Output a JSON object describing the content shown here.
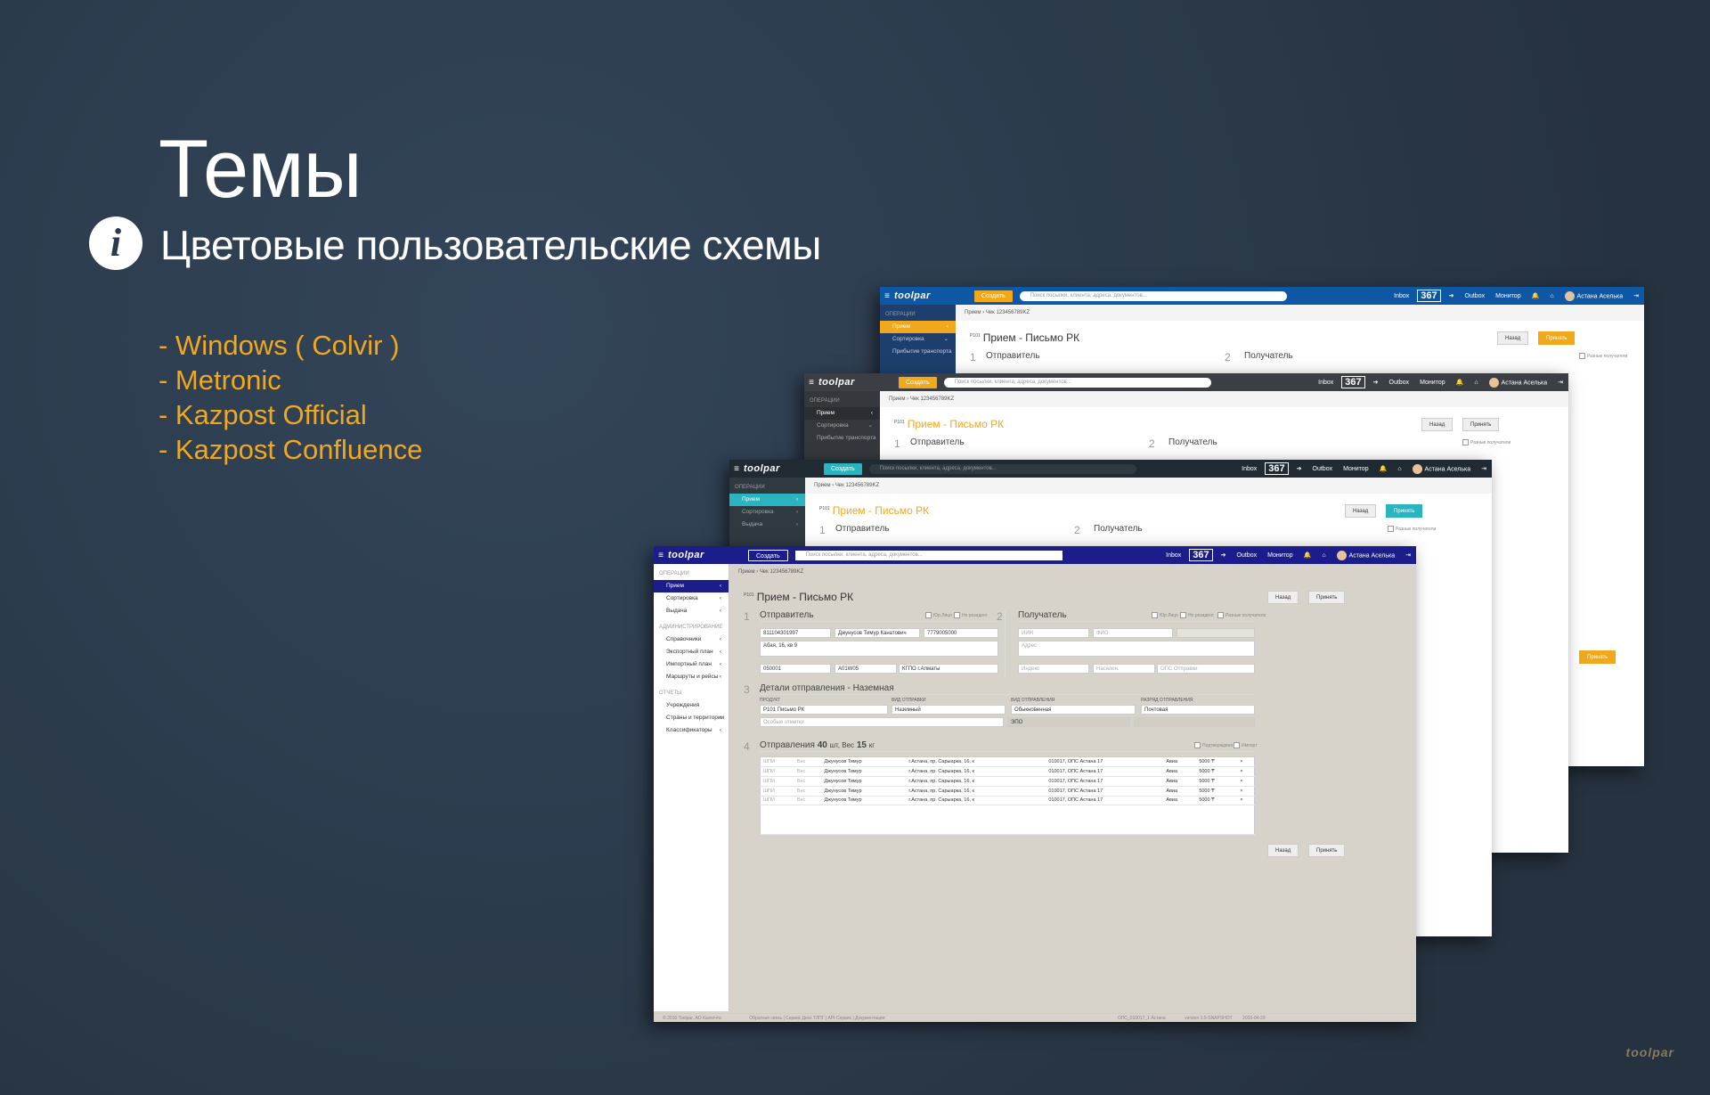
{
  "slide": {
    "title": "Темы",
    "subtitle": "Цветовые пользовательские схемы",
    "info_icon": "i",
    "themes": [
      "- Windows ( Colvir )",
      "- Metronic",
      "- Kazpost Official",
      "- Kazpost Confluence"
    ],
    "corner_logo": "toolpar",
    "accent_color": "#f2a81d",
    "background_color": "#2b3a4b"
  },
  "app": {
    "logo": "toolpar",
    "create_label": "Создать",
    "search_placeholder": "Поиск посылки, клиента, адреса, документов...",
    "inbox_label": "Inbox",
    "counter": "367",
    "outbox_label": "Outbox",
    "monitor_label": "Монитор",
    "user_name": "Астана Аселька",
    "breadcrumb_root": "Прием",
    "breadcrumb_item": "Чек 123456789KZ",
    "page_prefix": "P101",
    "page_title": "Прием - Письмо РК",
    "back_label": "Назад",
    "accept_label": "Принять",
    "sidebar": {
      "operations_head": "ОПЕРАЦИИ",
      "admin_head": "АДМИНИСТРИРОВАНИЕ",
      "reports_head": "ОТЧЕТЫ",
      "ops_items": [
        "Прием",
        "Сортировка",
        "Выдача"
      ],
      "admin_items": [
        "Справочники",
        "Экспортный план",
        "Импортный план",
        "Маршруты и рейсы"
      ],
      "report_items": [
        "Учреждения",
        "Страны и территории",
        "Классификаторы"
      ],
      "transport_item": "Прибытие транспорта"
    },
    "sender": {
      "num": "1",
      "title": "Отправитель",
      "iin": "811104301997",
      "name": "Джунусов Тимур Канатович",
      "phone": "7779005000",
      "address": "Абая, 16, кв 9",
      "index": "050001",
      "code": "A01W05",
      "ops": "КГПО г.Алматы",
      "chk_legal": "Юр.Лицо",
      "chk_resident": "Не резидент"
    },
    "receiver": {
      "num": "2",
      "title": "Получатель",
      "ph_iin": "ИИН",
      "ph_fio": "ФИО",
      "ph_address": "Адрес",
      "ph_index": "Индекс",
      "ph_city": "Населен.",
      "ph_ops": "ОПС Отправки",
      "chk_legal": "Юр.Лицо",
      "chk_resident": "Не резидент",
      "chk_diff": "Разные получатели"
    },
    "details": {
      "num": "3",
      "title": "Детали отправления - Наземная",
      "product_label": "ПРОДУКТ",
      "product_value": "P101 Письмо РК",
      "kind_label": "ВИД ОТПРАВКИ",
      "kind_value": "Наземный",
      "type_label": "ВИД ОТПРАВЛЕНИЯ",
      "type_value": "Обыкновенная",
      "rank_label": "РАЗРЯД ОТПРАВЛЕНИЯ",
      "rank_value": "Почтовая",
      "ph_notes": "Особые отметки",
      "epo_value": "ЭПО"
    },
    "shipments": {
      "num": "4",
      "title_prefix": "Отправления",
      "count": "40",
      "count_unit": "шт, Вес",
      "weight": "15",
      "weight_unit": "кг",
      "chk_confirm": "Подтверждено",
      "chk_import": "Импорт",
      "rows": [
        [
          "ШПИ",
          "Вес",
          "Джунусов Тимур",
          "г.Астана, пр. Сарыарка, 16, к",
          "010017, ОПС Астана 17",
          "Авиа",
          "5000 ₸",
          "×"
        ],
        [
          "ШПИ",
          "Вес",
          "Джунусов Тимур",
          "г.Астана, пр. Сарыарка, 16, к",
          "010017, ОПС Астана 17",
          "Авиа",
          "5000 ₸",
          "×"
        ],
        [
          "ШПИ",
          "Вес",
          "Джунусов Тимур",
          "г.Астана, пр. Сарыарка, 16, к",
          "010017, ОПС Астана 17",
          "Авиа",
          "5000 ₸",
          "×"
        ],
        [
          "ШПИ",
          "Вес",
          "Джунусов Тимур",
          "г.Астана, пр. Сарыарка, 16, к",
          "010017, ОПС Астана 17",
          "Авиа",
          "5000 ₸",
          "×"
        ],
        [
          "ШПИ",
          "Вес",
          "Джунусов Тимур",
          "г.Астана, пр. Сарыарка, 16, к",
          "010017, ОПС Астана 17",
          "Авиа",
          "5000 ₸",
          "×"
        ]
      ]
    },
    "footer": {
      "copyright": "© 2016 Toolpar, АО Казпочта",
      "links": "Обратная связь  |  Сервис Деск ТЛПГ  |  API Сервис  |  Документация",
      "ops": "ОПС_010017_1 Астана",
      "version": "version 1.0-SNAPSHOT",
      "date": "2016-04-29"
    }
  }
}
